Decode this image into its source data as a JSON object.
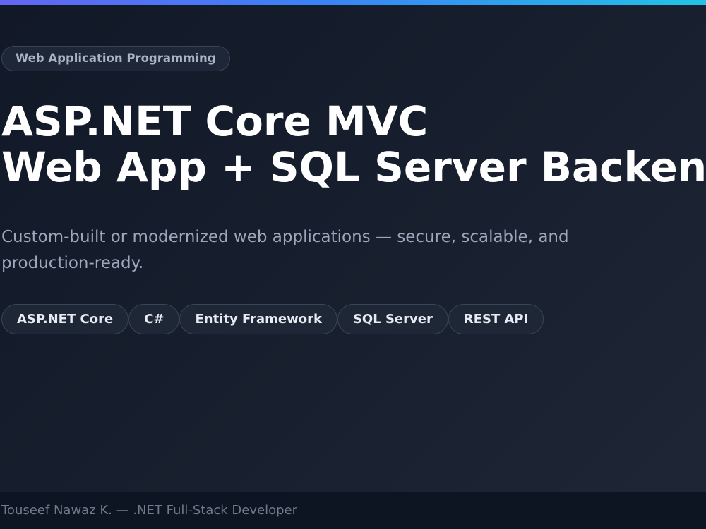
{
  "header": {
    "category": "Web Application Programming",
    "title_line_1": "ASP.NET Core MVC",
    "title_line_2": "Web App + SQL Server Backend"
  },
  "description": "Custom-built or modernized web applications — secure, scalable, and production-ready.",
  "tags": [
    "ASP.NET Core",
    "C#",
    "Entity Framework",
    "SQL Server",
    "REST API"
  ],
  "footer": {
    "author_text": "Touseef Nawaz K. — .NET Full-Stack Developer"
  },
  "colors": {
    "background_start": "#111827",
    "background_end": "#1f2737",
    "accent_start": "#6366f1",
    "accent_end": "#22c3e6",
    "title_text": "#ffffff",
    "muted_text": "#9ca7b8"
  }
}
